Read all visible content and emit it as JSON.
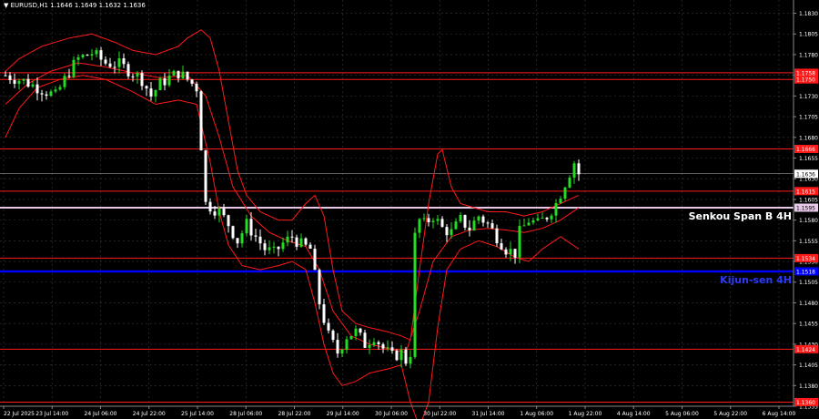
{
  "header": {
    "marker": "▼",
    "symbol": "EURUSD,H1",
    "ohlc": "1.1646 1.1649 1.1632 1.1636"
  },
  "colors": {
    "background": "#000000",
    "grid": "#3a3a3a",
    "bull": "#22dd22",
    "bear": "#ffffff",
    "level": "#ff1a1a",
    "senkou": "#e8c8e8",
    "kijun": "#0000ff",
    "bands": "#ff1a1a",
    "axis_text": "#ffffff"
  },
  "chart_data": {
    "type": "candlestick",
    "instrument": "EURUSD",
    "timeframe": "H1",
    "ylim": [
      1.1355,
      1.1846
    ],
    "y_ticks": [
      "1.1830",
      "1.1805",
      "1.1780",
      "1.1755",
      "1.1730",
      "1.1705",
      "1.1680",
      "1.1655",
      "1.1630",
      "1.1605",
      "1.1580",
      "1.1555",
      "1.1530",
      "1.1505",
      "1.1480",
      "1.1455",
      "1.1430",
      "1.1405",
      "1.1380",
      "1.1355"
    ],
    "x_ticks": [
      "22 Jul 2025",
      "23 Jul 14:00",
      "24 Jul 06:00",
      "24 Jul 22:00",
      "25 Jul 14:00",
      "28 Jul 06:00",
      "28 Jul 22:00",
      "29 Jul 14:00",
      "30 Jul 06:00",
      "30 Jul 22:00",
      "31 Jul 14:00",
      "1 Aug 06:00",
      "1 Aug 22:00",
      "4 Aug 14:00",
      "5 Aug 06:00",
      "5 Aug 22:00",
      "6 Aug 14:00"
    ],
    "levels": [
      {
        "value": 1.1758,
        "label": "1.1758",
        "color": "#ff1a1a"
      },
      {
        "value": 1.175,
        "label": "1.1750",
        "color": "#ff1a1a"
      },
      {
        "value": 1.1666,
        "label": "1.1666",
        "color": "#ff1a1a"
      },
      {
        "value": 1.1615,
        "label": "1.1615",
        "color": "#ff1a1a"
      },
      {
        "value": 1.1534,
        "label": "1.1534",
        "color": "#ff1a1a"
      },
      {
        "value": 1.1424,
        "label": "1.1424",
        "color": "#ff1a1a"
      },
      {
        "value": 1.136,
        "label": "1.1360",
        "color": "#ff1a1a"
      }
    ],
    "senkou": {
      "value": 1.1595,
      "label": "Senkou Span B 4H",
      "price_label": "1.1595"
    },
    "kijun": {
      "value": 1.1518,
      "label": "Kijun-sen 4H",
      "price_label": "1.1518"
    },
    "current_price": {
      "value": 1.1636,
      "label": "1.1636"
    },
    "price_path": [
      [
        0,
        1.1755
      ],
      [
        4,
        1.1748
      ],
      [
        8,
        1.1738
      ],
      [
        11,
        1.173
      ],
      [
        14,
        1.176
      ],
      [
        16,
        1.1775
      ],
      [
        19,
        1.1782
      ],
      [
        22,
        1.177
      ],
      [
        25,
        1.1768
      ],
      [
        28,
        1.1758
      ],
      [
        30,
        1.175
      ],
      [
        32,
        1.173
      ],
      [
        34,
        1.1745
      ],
      [
        36,
        1.1752
      ],
      [
        38,
        1.1758
      ],
      [
        40,
        1.175
      ],
      [
        42,
        1.174
      ],
      [
        44,
        1.16
      ],
      [
        47,
        1.159
      ],
      [
        49,
        1.1575
      ],
      [
        51,
        1.1555
      ],
      [
        53,
        1.1575
      ],
      [
        55,
        1.156
      ],
      [
        57,
        1.1545
      ],
      [
        59,
        1.154
      ],
      [
        61,
        1.1552
      ],
      [
        63,
        1.156
      ],
      [
        65,
        1.155
      ],
      [
        67,
        1.1545
      ],
      [
        69,
        1.148
      ],
      [
        71,
        1.144
      ],
      [
        73,
        1.142
      ],
      [
        75,
        1.144
      ],
      [
        77,
        1.1445
      ],
      [
        79,
        1.143
      ],
      [
        81,
        1.144
      ],
      [
        83,
        1.1425
      ],
      [
        85,
        1.1415
      ],
      [
        87,
        1.142
      ],
      [
        88,
        1.141
      ],
      [
        89,
        1.142
      ],
      [
        90,
        1.156
      ],
      [
        91,
        1.158
      ],
      [
        92,
        1.1575
      ],
      [
        94,
        1.1585
      ],
      [
        96,
        1.157
      ],
      [
        98,
        1.1565
      ],
      [
        100,
        1.158
      ],
      [
        102,
        1.157
      ],
      [
        104,
        1.1585
      ],
      [
        106,
        1.1575
      ],
      [
        108,
        1.156
      ],
      [
        110,
        1.1545
      ],
      [
        112,
        1.154
      ],
      [
        113,
        1.1565
      ],
      [
        115,
        1.158
      ],
      [
        117,
        1.1575
      ],
      [
        119,
        1.1585
      ],
      [
        121,
        1.16
      ],
      [
        123,
        1.1625
      ],
      [
        125,
        1.165
      ],
      [
        126,
        1.1636
      ]
    ],
    "band_upper": [
      [
        0,
        1.176
      ],
      [
        3,
        1.1775
      ],
      [
        8,
        1.179
      ],
      [
        14,
        1.18
      ],
      [
        19,
        1.1805
      ],
      [
        24,
        1.1795
      ],
      [
        28,
        1.1785
      ],
      [
        33,
        1.178
      ],
      [
        38,
        1.179
      ],
      [
        40,
        1.18
      ],
      [
        43,
        1.181
      ],
      [
        45,
        1.18
      ],
      [
        47,
        1.176
      ],
      [
        49,
        1.17
      ],
      [
        51,
        1.164
      ],
      [
        53,
        1.161
      ],
      [
        56,
        1.159
      ],
      [
        60,
        1.158
      ],
      [
        63,
        1.158
      ],
      [
        66,
        1.16
      ],
      [
        68,
        1.161
      ],
      [
        70,
        1.1585
      ],
      [
        72,
        1.152
      ],
      [
        74,
        1.147
      ],
      [
        77,
        1.1455
      ],
      [
        80,
        1.145
      ],
      [
        84,
        1.1445
      ],
      [
        87,
        1.144
      ],
      [
        89,
        1.1435
      ],
      [
        91,
        1.152
      ],
      [
        93,
        1.16
      ],
      [
        95,
        1.166
      ],
      [
        96,
        1.1665
      ],
      [
        98,
        1.162
      ],
      [
        100,
        1.16
      ],
      [
        103,
        1.1595
      ],
      [
        106,
        1.159
      ],
      [
        110,
        1.159
      ],
      [
        114,
        1.1585
      ],
      [
        118,
        1.159
      ],
      [
        122,
        1.16
      ],
      [
        126,
        1.161
      ]
    ],
    "band_lower": [
      [
        0,
        1.168
      ],
      [
        3,
        1.1715
      ],
      [
        7,
        1.174
      ],
      [
        12,
        1.175
      ],
      [
        17,
        1.1755
      ],
      [
        22,
        1.175
      ],
      [
        28,
        1.1735
      ],
      [
        33,
        1.172
      ],
      [
        38,
        1.1725
      ],
      [
        42,
        1.172
      ],
      [
        45,
        1.165
      ],
      [
        47,
        1.159
      ],
      [
        49,
        1.155
      ],
      [
        52,
        1.1525
      ],
      [
        56,
        1.152
      ],
      [
        60,
        1.1525
      ],
      [
        63,
        1.153
      ],
      [
        66,
        1.152
      ],
      [
        68,
        1.148
      ],
      [
        70,
        1.143
      ],
      [
        72,
        1.1395
      ],
      [
        74,
        1.138
      ],
      [
        77,
        1.1385
      ],
      [
        80,
        1.1395
      ],
      [
        84,
        1.14
      ],
      [
        87,
        1.1405
      ],
      [
        89,
        1.136
      ],
      [
        91,
        1.133
      ],
      [
        93,
        1.136
      ],
      [
        95,
        1.145
      ],
      [
        97,
        1.152
      ],
      [
        100,
        1.1545
      ],
      [
        104,
        1.1555
      ],
      [
        108,
        1.1548
      ],
      [
        112,
        1.1535
      ],
      [
        115,
        1.153
      ],
      [
        118,
        1.1545
      ],
      [
        122,
        1.156
      ],
      [
        126,
        1.1545
      ]
    ],
    "ma_middle": [
      [
        0,
        1.172
      ],
      [
        5,
        1.1745
      ],
      [
        10,
        1.176
      ],
      [
        16,
        1.177
      ],
      [
        22,
        1.1765
      ],
      [
        28,
        1.1758
      ],
      [
        34,
        1.1752
      ],
      [
        40,
        1.1755
      ],
      [
        44,
        1.173
      ],
      [
        47,
        1.168
      ],
      [
        50,
        1.162
      ],
      [
        54,
        1.1585
      ],
      [
        58,
        1.1565
      ],
      [
        62,
        1.1555
      ],
      [
        66,
        1.1548
      ],
      [
        69,
        1.152
      ],
      [
        72,
        1.147
      ],
      [
        76,
        1.144
      ],
      [
        80,
        1.143
      ],
      [
        84,
        1.1425
      ],
      [
        88,
        1.142
      ],
      [
        91,
        1.147
      ],
      [
        94,
        1.153
      ],
      [
        98,
        1.156
      ],
      [
        102,
        1.1568
      ],
      [
        106,
        1.157
      ],
      [
        110,
        1.1568
      ],
      [
        114,
        1.1565
      ],
      [
        118,
        1.157
      ],
      [
        122,
        1.158
      ],
      [
        126,
        1.1595
      ]
    ]
  }
}
